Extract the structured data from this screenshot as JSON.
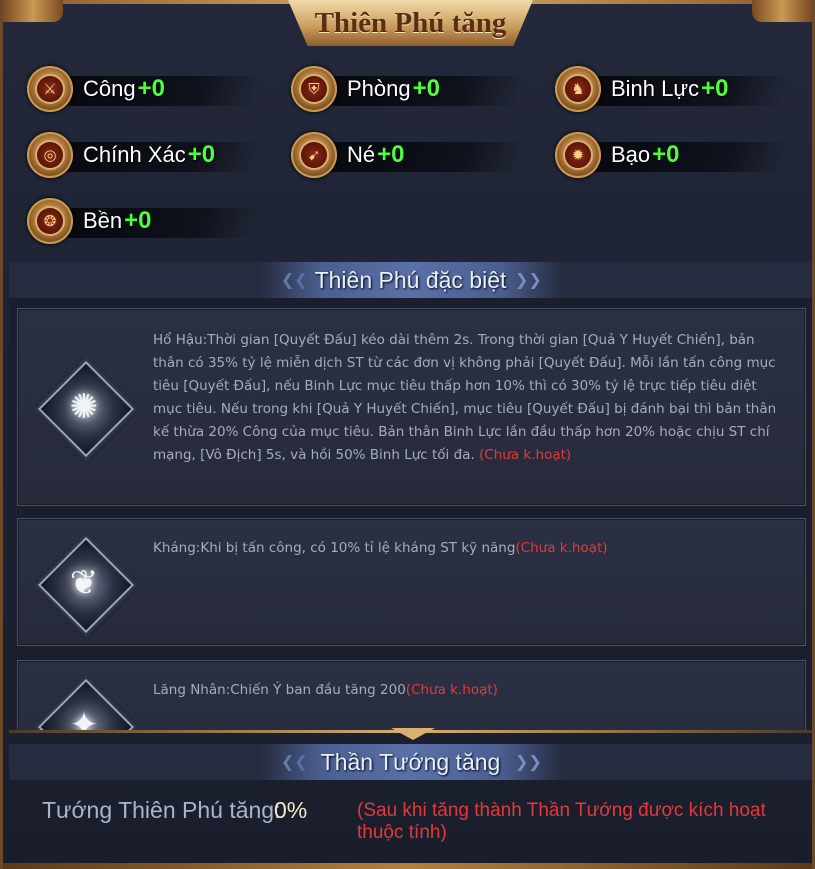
{
  "panel": {
    "title": "Thiên Phú tăng"
  },
  "stats": [
    {
      "label": "Công",
      "value": "+0",
      "icon": "sword-medal-icon",
      "glyph": "⚔"
    },
    {
      "label": "Phòng",
      "value": "+0",
      "icon": "shield-medal-icon",
      "glyph": "⛨"
    },
    {
      "label": "Binh Lực",
      "value": "+0",
      "icon": "troops-medal-icon",
      "glyph": "♞"
    },
    {
      "label": "Chính Xác",
      "value": "+0",
      "icon": "target-medal-icon",
      "glyph": "◎"
    },
    {
      "label": "Né",
      "value": "+0",
      "icon": "dodge-medal-icon",
      "glyph": "➹"
    },
    {
      "label": "Bạo",
      "value": "+0",
      "icon": "critical-medal-icon",
      "glyph": "✹"
    },
    {
      "label": "Bền",
      "value": "+0",
      "icon": "endurance-medal-icon",
      "glyph": "❂"
    }
  ],
  "special": {
    "heading": "Thiên Phú đặc biệt",
    "talents": [
      {
        "icon": "lightning-talent-icon",
        "glyph": "✺",
        "text": "Hổ Hậu:Thời gian [Quyết Đấu] kéo dài thêm 2s. Trong thời gian [Quả Y Huyết Chiến], bản thân có 35% tỷ lệ miễn dịch ST từ các đơn vị không phải [Quyết Đấu]. Mỗi lần tấn công mục tiêu [Quyết Đấu], nếu Binh Lực mục tiêu thấp hơn 10% thì có 30% tỷ lệ trực tiếp tiêu diệt mục tiêu. Nếu trong khi [Quả Y Huyết Chiến], mục tiêu [Quyết Đấu] bị đánh bại thì bản thân kế thừa 20% Công của mục tiêu. Bản thân Binh Lực lần đầu thấp hơn 20% hoặc chịu ST chí mạng, [Vô Địch] 5s, và hồi 50% Binh Lực tối đa.",
        "status": "(Chưa k.hoạt)"
      },
      {
        "icon": "resist-talent-icon",
        "glyph": "❦",
        "text": "Kháng:Khi bị tấn công, có 10% tỉ lệ kháng ST kỹ năng",
        "status": "(Chưa k.hoạt)"
      },
      {
        "icon": "warcry-talent-icon",
        "glyph": "✦",
        "text": "Lăng Nhân:Chiến Ý ban đầu tăng 200",
        "status": "(Chưa k.hoạt)"
      }
    ]
  },
  "general": {
    "heading": "Thần Tướng tăng",
    "label": "Tướng Thiên Phú tăng:",
    "value": "0%",
    "note": "(Sau khi tăng thành Thần Tướng được kích hoạt thuộc tính)"
  },
  "colors": {
    "stat_value": "#4dff3a",
    "inactive": "#e03a3a",
    "gold": "#d9b070"
  }
}
